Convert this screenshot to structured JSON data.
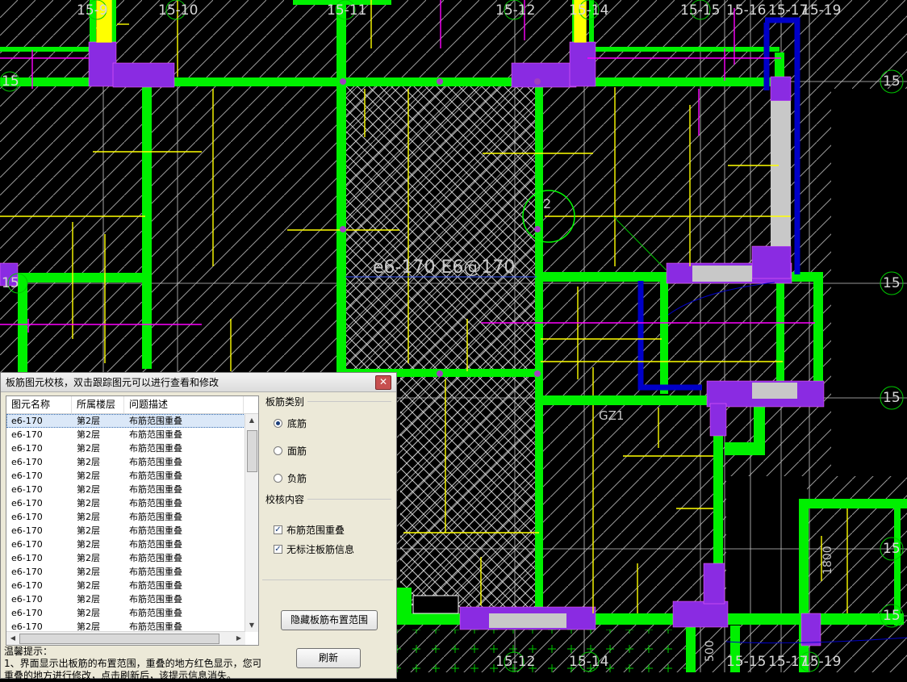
{
  "axis_labels": {
    "top": [
      "15-9",
      "15-10",
      "15-11",
      "15-12",
      "15-14",
      "15-15",
      "15-16",
      "15-17",
      "15-19"
    ],
    "right": [
      "15",
      "15",
      "15",
      "15",
      "15"
    ],
    "left": [
      "15",
      "15"
    ],
    "bottom": [
      "15-12",
      "15-14",
      "15-15",
      "15-17",
      "15-19"
    ]
  },
  "annotations": {
    "slab_label": "e6-170 E6@170",
    "circle_mark": "2",
    "gz_label": "GZ1",
    "dim_label": "1800",
    "bottom_dim": "500"
  },
  "dialog": {
    "title": "板筋图元校核，双击跟踪图元可以进行查看和修改",
    "close": "✕",
    "columns": [
      "图元名称",
      "所属楼层",
      "问题描述"
    ],
    "rows": [
      [
        "e6-170",
        "第2层",
        "布筋范围重叠"
      ],
      [
        "e6-170",
        "第2层",
        "布筋范围重叠"
      ],
      [
        "e6-170",
        "第2层",
        "布筋范围重叠"
      ],
      [
        "e6-170",
        "第2层",
        "布筋范围重叠"
      ],
      [
        "e6-170",
        "第2层",
        "布筋范围重叠"
      ],
      [
        "e6-170",
        "第2层",
        "布筋范围重叠"
      ],
      [
        "e6-170",
        "第2层",
        "布筋范围重叠"
      ],
      [
        "e6-170",
        "第2层",
        "布筋范围重叠"
      ],
      [
        "e6-170",
        "第2层",
        "布筋范围重叠"
      ],
      [
        "e6-170",
        "第2层",
        "布筋范围重叠"
      ],
      [
        "e6-170",
        "第2层",
        "布筋范围重叠"
      ],
      [
        "e6-170",
        "第2层",
        "布筋范围重叠"
      ],
      [
        "e6-170",
        "第2层",
        "布筋范围重叠"
      ],
      [
        "e6-170",
        "第2层",
        "布筋范围重叠"
      ],
      [
        "e6-170",
        "第2层",
        "布筋范围重叠"
      ],
      [
        "e6-170",
        "第2层",
        "布筋范围重叠"
      ]
    ],
    "selected_row": 0,
    "rebar_type": {
      "label": "板筋类别",
      "options": [
        "底筋",
        "面筋",
        "负筋"
      ],
      "selected": "底筋"
    },
    "check_content": {
      "label": "校核内容",
      "options": [
        {
          "label": "布筋范围重叠",
          "checked": true
        },
        {
          "label": "无标注板筋信息",
          "checked": true
        }
      ]
    },
    "buttons": {
      "hide": "隐藏板筋布置范围",
      "refresh": "刷新"
    },
    "tips": {
      "heading": "温馨提示：",
      "line1": "1、界面显示出板筋的布置范围，重叠的地方红色显示，您可",
      "line2": "重叠的地方进行修改，点击刷新后，该提示信息消失。"
    }
  },
  "colors": {
    "wall": "#00ff00",
    "rebar": "#ffff00",
    "magenta": "#ff00ff",
    "column": "#8a2be2",
    "blue": "#0000c8"
  }
}
